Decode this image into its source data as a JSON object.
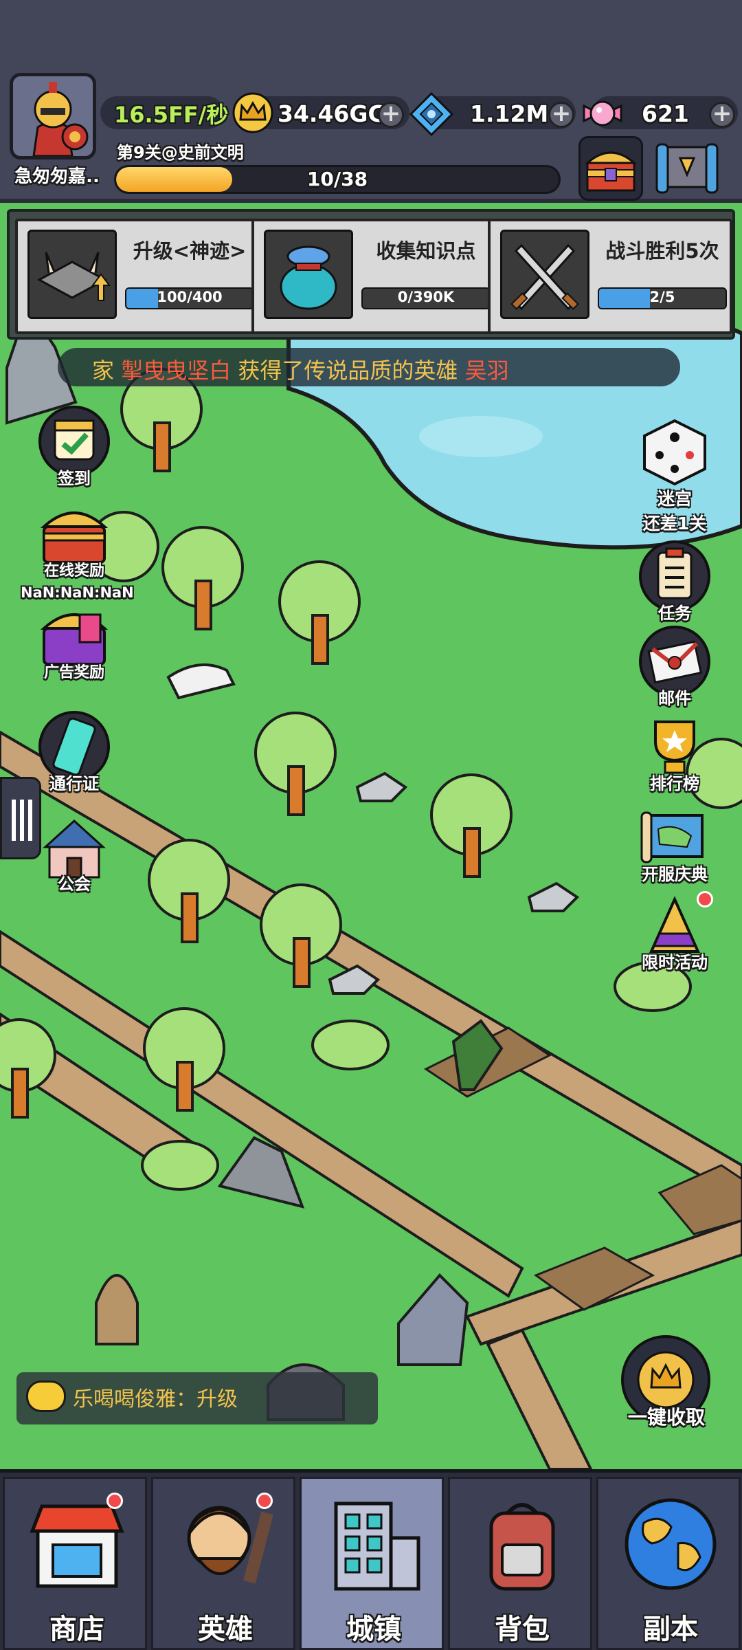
{
  "player": {
    "name": "急匆匆嘉..",
    "income": "16.5FF/秒",
    "stage": "第9关@史前文明",
    "progress_text": "10/38",
    "progress": 0.263
  },
  "resources": [
    {
      "icon": "crown-icon",
      "value": "34.46GG"
    },
    {
      "icon": "gem-icon",
      "value": "1.12M"
    },
    {
      "icon": "candy-icon",
      "value": "621"
    }
  ],
  "quests": [
    {
      "title": "升级<神迹>",
      "progress_text": "100/400",
      "progress": 0.25,
      "icon": "altar-icon"
    },
    {
      "title": "收集知识点",
      "progress_text": "0/390K",
      "progress": 0.0,
      "icon": "treasure-bag-icon"
    },
    {
      "title": "战斗胜利5次",
      "progress_text": "2/5",
      "progress": 0.4,
      "icon": "crossed-swords-icon"
    }
  ],
  "announcement": {
    "prefix": "家",
    "player": "掣曳曳坚白",
    "middle": "获得了传说品质的英雄",
    "hero": "吴羽"
  },
  "left_buttons": [
    {
      "label": "签到",
      "icon": "calendar-check-icon"
    },
    {
      "label": "在线奖励",
      "icon": "chest-icon",
      "timer": "NaN:NaN:NaN"
    },
    {
      "label": "广告奖励",
      "icon": "ad-chest-icon"
    },
    {
      "label": "通行证",
      "icon": "pass-ticket-icon"
    },
    {
      "label": "公会",
      "icon": "castle-icon"
    }
  ],
  "right_buttons": [
    {
      "label": "迷宫",
      "sub": "还差1关",
      "icon": "dice-icon"
    },
    {
      "label": "任务",
      "icon": "clipboard-icon"
    },
    {
      "label": "邮件",
      "icon": "mail-icon"
    },
    {
      "label": "排行榜",
      "icon": "trophy-icon"
    },
    {
      "label": "开服庆典",
      "icon": "scroll-map-icon"
    },
    {
      "label": "限时活动",
      "icon": "gift-icon"
    }
  ],
  "collect_all": "一键收取",
  "chat": {
    "text": "乐喝喝俊雅：升级"
  },
  "nav": [
    {
      "label": "商店",
      "icon": "shop-icon",
      "badge": true
    },
    {
      "label": "英雄",
      "icon": "caveman-icon",
      "badge": true
    },
    {
      "label": "城镇",
      "icon": "building-icon",
      "badge": false
    },
    {
      "label": "背包",
      "icon": "backpack-icon",
      "badge": false
    },
    {
      "label": "副本",
      "icon": "globe-icon",
      "badge": false
    }
  ]
}
